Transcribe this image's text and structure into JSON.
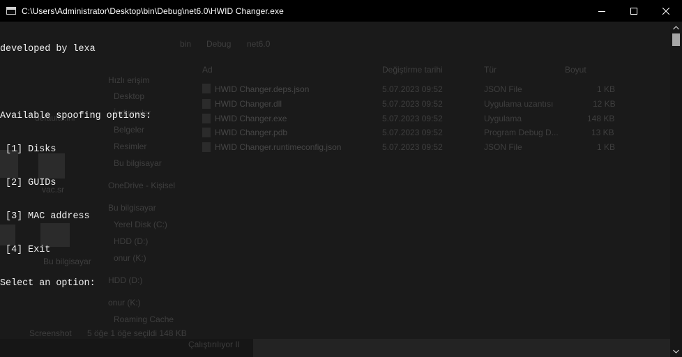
{
  "window": {
    "title": "C:\\Users\\Administrator\\Desktop\\bin\\Debug\\net6.0\\HWID Changer.exe"
  },
  "console": {
    "lines": [
      "developed by lexa",
      "",
      "Available spoofing options:",
      " [1] Disks",
      " [2] GUIDs",
      " [3] MAC address",
      " [4] Exit",
      "Select an option:"
    ],
    "text_color": "#f2f2f2",
    "background": "#0c0c0c"
  },
  "background_window": {
    "breadcrumb": [
      "bin",
      "Debug",
      "net6.0"
    ],
    "columns": [
      "Ad",
      "Değiştirme tarihi",
      "Tür",
      "Boyut"
    ],
    "files": [
      {
        "name": "HWID Changer.deps.json",
        "date": "5.07.2023 09:52",
        "type": "JSON File",
        "size": "1 KB"
      },
      {
        "name": "HWID Changer.dll",
        "date": "5.07.2023 09:52",
        "type": "Uygulama uzantısı",
        "size": "12 KB"
      },
      {
        "name": "HWID Changer.exe",
        "date": "5.07.2023 09:52",
        "type": "Uygulama",
        "size": "148 KB"
      },
      {
        "name": "HWID Changer.pdb",
        "date": "5.07.2023 09:52",
        "type": "Program Debug D...",
        "size": "13 KB"
      },
      {
        "name": "HWID Changer.runtimeconfig.json",
        "date": "5.07.2023 09:52",
        "type": "JSON File",
        "size": "1 KB"
      }
    ],
    "nav": [
      "Hızlı erişim",
      "Desktop",
      "İndirmeler",
      "Belgeler",
      "Resimler",
      "Bu bilgisayar",
      "OneDrive - Kişisel",
      "Bu bilgisayar",
      "Yerel Disk (C:)",
      "HDD (D:)",
      "onur (K:)",
      "HDD (D:)",
      "onur (K:)",
      "Roaming Cache"
    ],
    "status": "5 öğe   1 öğe seçildi   148 KB",
    "desktop_labels": [
      "defaults.ini",
      "vac.sr",
      "Bu bilgisayar",
      "Screenshot"
    ],
    "taskbar_hint": "Çalıştırılıyor II"
  },
  "colors": {
    "titlebar": "#000000",
    "title_text": "#ffffff",
    "scrollbar_track": "#171717",
    "scrollbar_thumb": "#a6a6a6"
  }
}
